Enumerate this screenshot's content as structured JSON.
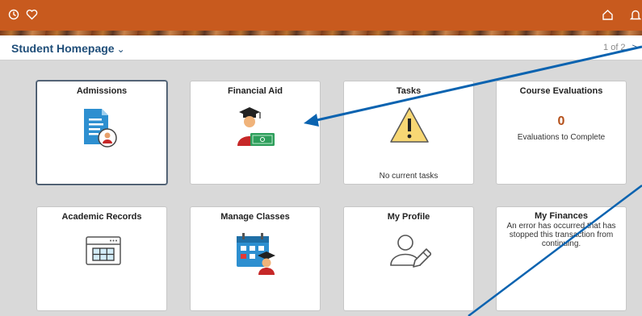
{
  "header": {
    "history_icon": "clock-icon",
    "favorites_icon": "heart-icon",
    "home_icon": "home-icon",
    "notifications_icon": "bell-icon",
    "bar_color": "#c85a1e"
  },
  "page": {
    "title": "Student Homepage",
    "page_indicator": "1 of 2"
  },
  "tiles": {
    "admissions": {
      "title": "Admissions",
      "icon": "admission-document-icon"
    },
    "financial_aid": {
      "title": "Financial Aid",
      "icon": "graduate-money-icon"
    },
    "tasks": {
      "title": "Tasks",
      "icon": "warning-icon",
      "text": "No current tasks"
    },
    "course_evaluations": {
      "title": "Course Evaluations",
      "count": "0",
      "text": "Evaluations to Complete"
    },
    "academic_records": {
      "title": "Academic Records",
      "icon": "calendar-grid-icon"
    },
    "manage_classes": {
      "title": "Manage Classes",
      "icon": "class-calendar-icon"
    },
    "my_profile": {
      "title": "My Profile",
      "icon": "profile-edit-icon"
    },
    "my_finances": {
      "title": "My Finances",
      "error_text": "An error has occurred that has stopped this transaction from continuing."
    }
  },
  "annotations": {
    "arrow_color": "#0a63b0"
  }
}
